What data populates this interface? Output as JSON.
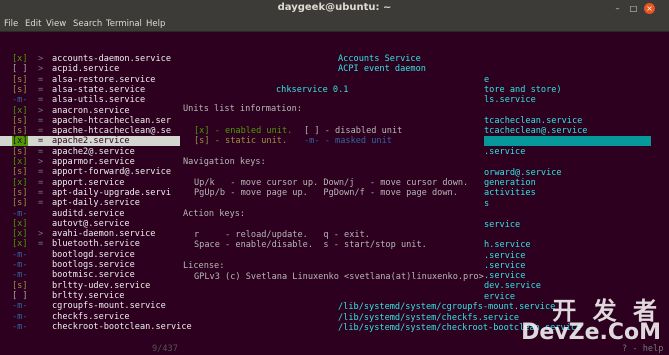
{
  "window": {
    "title": "daygeek@ubuntu: ~"
  },
  "menu": [
    "File",
    "Edit",
    "View",
    "Search",
    "Terminal",
    "Help"
  ],
  "colors": {
    "enabled": "#4e9a06",
    "disabled": "#a7a7a7",
    "static": "#9e8f4c",
    "masked": "#3465a4",
    "cyan": "#34e2e2",
    "background": "#2c001e"
  },
  "services": [
    {
      "mark": "[x]",
      "arrow": ">",
      "name": "accounts-daemon.service",
      "status": "enabled"
    },
    {
      "mark": "[ ]",
      "arrow": ">",
      "name": "acpid.service",
      "status": "disabled"
    },
    {
      "mark": "[s]",
      "arrow": "=",
      "name": "alsa-restore.service",
      "status": "static"
    },
    {
      "mark": "[s]",
      "arrow": "=",
      "name": "alsa-state.service",
      "status": "static"
    },
    {
      "mark": "-m-",
      "arrow": "=",
      "name": "alsa-utils.service",
      "status": "masked"
    },
    {
      "mark": "[x]",
      "arrow": ">",
      "name": "anacron.service",
      "status": "enabled"
    },
    {
      "mark": "[s]",
      "arrow": "=",
      "name": "apache-htcacheclean.ser",
      "status": "static"
    },
    {
      "mark": "[s]",
      "arrow": "=",
      "name": "apache-htcacheclean@.se",
      "status": "static"
    },
    {
      "mark": "[x]",
      "arrow": "=",
      "name": "apache2.service",
      "status": "enabled",
      "selected": true
    },
    {
      "mark": "[s]",
      "arrow": "=",
      "name": "apache2@.service",
      "status": "static"
    },
    {
      "mark": "[x]",
      "arrow": ">",
      "name": "apparmor.service",
      "status": "enabled"
    },
    {
      "mark": "[s]",
      "arrow": "=",
      "name": "apport-forward@.service",
      "status": "static"
    },
    {
      "mark": "[x]",
      "arrow": "=",
      "name": "apport.service",
      "status": "enabled"
    },
    {
      "mark": "[s]",
      "arrow": "=",
      "name": "apt-daily-upgrade.servi",
      "status": "static"
    },
    {
      "mark": "[s]",
      "arrow": "=",
      "name": "apt-daily.service",
      "status": "static"
    },
    {
      "mark": "-m-",
      "arrow": "",
      "name": "auditd.service",
      "status": "masked"
    },
    {
      "mark": "[x]",
      "arrow": "",
      "name": "autovt@.service",
      "status": "enabled"
    },
    {
      "mark": "[x]",
      "arrow": ">",
      "name": "avahi-daemon.service",
      "status": "enabled"
    },
    {
      "mark": "[x]",
      "arrow": "=",
      "name": "bluetooth.service",
      "status": "enabled"
    },
    {
      "mark": "-m-",
      "arrow": "",
      "name": "bootlogd.service",
      "status": "masked"
    },
    {
      "mark": "-m-",
      "arrow": "",
      "name": "bootlogs.service",
      "status": "masked"
    },
    {
      "mark": "-m-",
      "arrow": "",
      "name": "bootmisc.service",
      "status": "masked"
    },
    {
      "mark": "[s]",
      "arrow": "",
      "name": "brltty-udev.service",
      "status": "static"
    },
    {
      "mark": "[ ]",
      "arrow": "",
      "name": "brltty.service",
      "status": "disabled"
    },
    {
      "mark": "-m-",
      "arrow": "",
      "name": "cgroupfs-mount.service",
      "status": "masked"
    },
    {
      "mark": "-m-",
      "arrow": "",
      "name": "checkfs.service",
      "status": "masked"
    },
    {
      "mark": "-m-",
      "arrow": "",
      "name": "checkroot-bootclean.service",
      "status": "masked"
    }
  ],
  "right_column": [
    "Accounts Service",
    "ACPI event daemon",
    "e",
    "tore and store)",
    "ls.service",
    "tcacheclean.service",
    "tcacheclean@.service",
    ".service",
    "orward@.service",
    "generation",
    "activities",
    "s",
    "service",
    "h.service",
    ".service",
    ".service",
    ".service",
    "dev.service",
    "ervice",
    "/lib/systemd/system/cgroupfs-mount.service",
    "/lib/systemd/system/checkfs.service",
    "/lib/systemd/system/checkroot-bootclean.service"
  ],
  "help": {
    "title": "chkservice 0.1",
    "units_heading": "Units list information:",
    "enabled_label": "[x] - enabled unit.",
    "disabled_label": "[ ] - disabled unit",
    "static_label": "[s] - static unit.",
    "masked_label": "-m- - masked unit",
    "nav_heading": "Navigation keys:",
    "nav_line1": "Up/k   - move cursor up. Down/j   - move cursor down.",
    "nav_line2": "PgUp/b - move page up.   PgDown/f - move page down.",
    "action_heading": "Action keys:",
    "action_line1": "r     - reload/update.   q - exit.",
    "action_line2": "Space - enable/disable.  s - start/stop unit.",
    "license_heading": "License:",
    "license_text": "GPLv3 (c) Svetlana Linuxenko <svetlana(at)linuxenko.pro>"
  },
  "footer": {
    "position": "9/437",
    "help_hint": "? - help"
  },
  "watermark": {
    "line1": "开 发 者",
    "line2": "DevZe.CoM"
  }
}
